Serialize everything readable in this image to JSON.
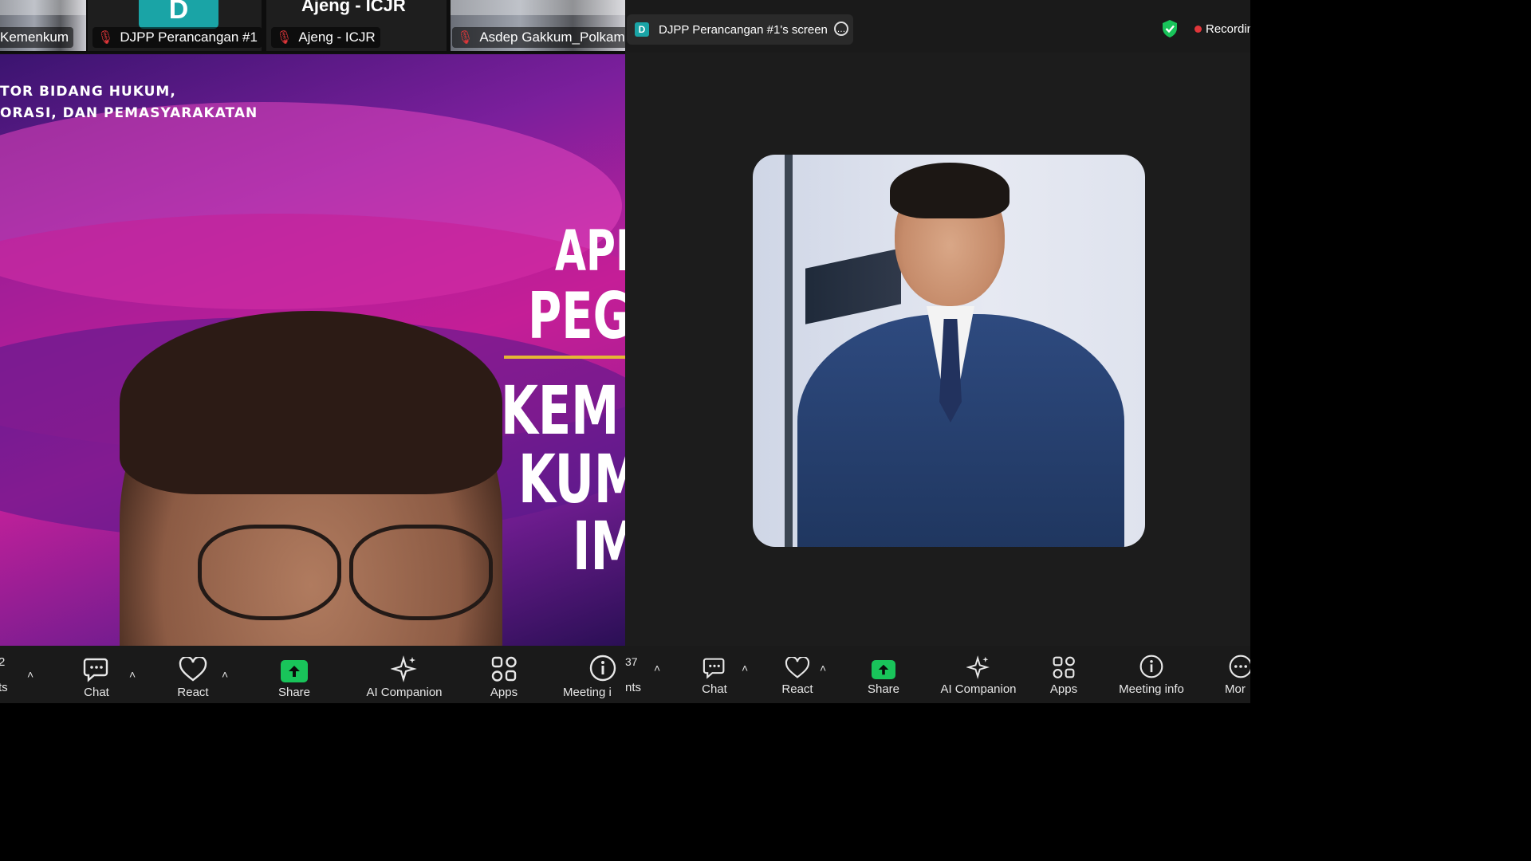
{
  "left": {
    "thumbnails": [
      {
        "name": "Kemenkum"
      },
      {
        "name": "DJPP Perancangan #1",
        "avatar_letter": "D"
      },
      {
        "name": "Ajeng - ICJR",
        "big_name": "Ajeng - ICJR"
      },
      {
        "name": "Asdep Gakkum_Polkam"
      }
    ],
    "slide": {
      "subtitle": "TOR BIDANG HUKUM,\nORASI, DAN PEMASYARAKATAN",
      "line1": "APE",
      "line2": "PEG",
      "line3": "KEM",
      "line4": "KUM",
      "line5": "IM"
    },
    "toolbar": {
      "participants_count": "2",
      "participants_label": "ts",
      "chat": "Chat",
      "react": "React",
      "share": "Share",
      "ai": "AI Companion",
      "apps": "Apps",
      "info": "Meeting i"
    }
  },
  "right": {
    "share_pill": {
      "letter": "D",
      "label": "DJPP Perancangan #1's screen"
    },
    "recording": "Recordin",
    "toolbar": {
      "participants_count": "37",
      "participants_label": "nts",
      "chat": "Chat",
      "react": "React",
      "share": "Share",
      "ai": "AI Companion",
      "apps": "Apps",
      "info": "Meeting info",
      "more": "Mor"
    }
  },
  "colors": {
    "accent_green": "#19c45a",
    "recording_red": "#e0363a",
    "avatar_teal": "#1aa4a6"
  }
}
